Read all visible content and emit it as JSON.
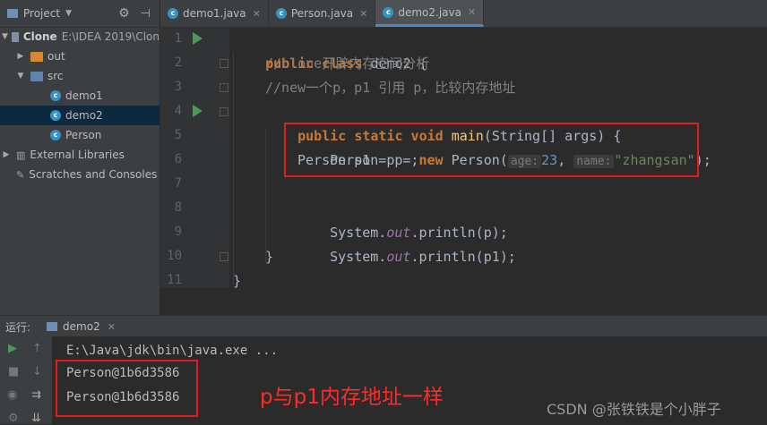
{
  "project_panel": {
    "title": "Project",
    "tree": [
      {
        "label": "Clone",
        "suffix": "E:\\IDEA 2019\\Clon",
        "type": "module"
      },
      {
        "label": "out",
        "type": "folder"
      },
      {
        "label": "src",
        "type": "folder"
      },
      {
        "label": "demo1",
        "type": "java"
      },
      {
        "label": "demo2",
        "type": "java",
        "selected": true
      },
      {
        "label": "Person",
        "type": "java"
      },
      {
        "label": "External Libraries",
        "type": "library"
      },
      {
        "label": "Scratches and Consoles",
        "type": "scratch"
      }
    ]
  },
  "tabs": [
    {
      "label": "demo1.java"
    },
    {
      "label": "Person.java"
    },
    {
      "label": "demo2.java",
      "active": true
    }
  ],
  "editor": {
    "line_numbers": [
      "1",
      "2",
      "3",
      "4",
      "5",
      "6",
      "7",
      "8",
      "9",
      "10",
      "11"
    ],
    "lines": {
      "l1_kw": "public class ",
      "l1_name": "demo2",
      "l1_rest": " {",
      "l2": "//clone开辟内存空间分析",
      "l3": "//new一个p，p1 引用 p，比较内存地址",
      "l4_kw": "public static void ",
      "l4_fn": "main",
      "l4_rest1": "(",
      "l4_type": "String",
      "l4_rest2": "[] args) {",
      "l5_a": "Person p = ",
      "l5_new": "new ",
      "l5_b": "Person(",
      "l5_hint1": "age:",
      "l5_num": "23",
      "l5_comma": ", ",
      "l5_hint2": "name:",
      "l5_str": "\"zhangsan\"",
      "l5_end": ");",
      "l6": "Person p1 = p ;",
      "l8_a": "System.",
      "l8_out": "out",
      "l8_b": ".println(p);",
      "l9_a": "System.",
      "l9_out": "out",
      "l9_b": ".println(p1);",
      "l10": "}",
      "l11": "}"
    }
  },
  "run_panel": {
    "label": "运行:",
    "tab": "demo2",
    "output": [
      "E:\\Java\\jdk\\bin\\java.exe ...",
      "Person@1b6d3586",
      "Person@1b6d3586"
    ]
  },
  "annotation": "p与p1内存地址一样",
  "watermark": "CSDN @张铁铁是个小胖子",
  "colors": {
    "run_green": "#499c54",
    "annotation_red": "#ff2b2b",
    "selection": "#0d293e"
  }
}
